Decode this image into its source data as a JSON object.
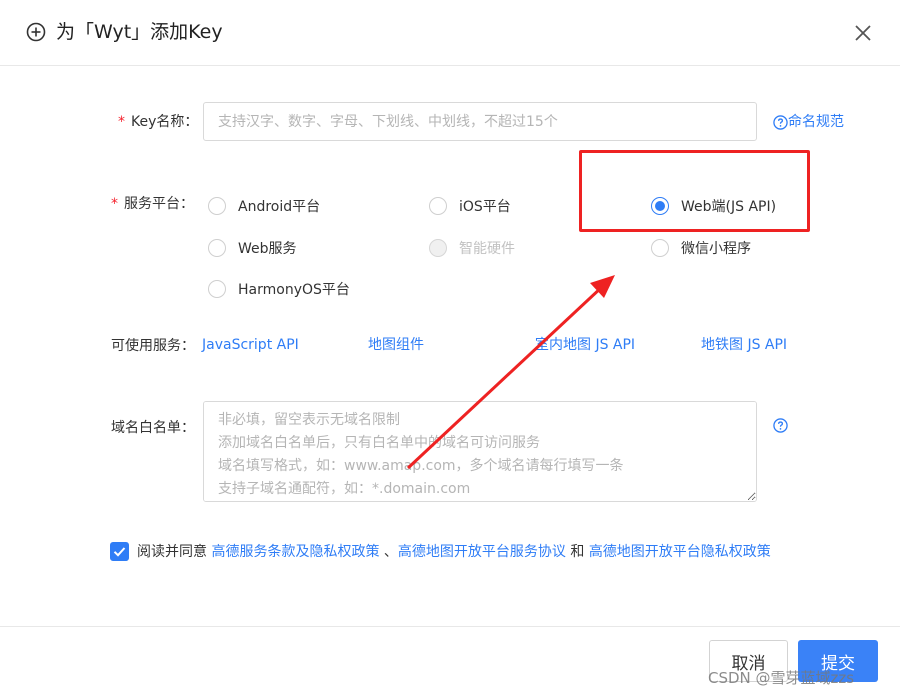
{
  "header": {
    "title": "为「Wyt」添加Key",
    "add_icon": "circle-plus-icon",
    "close_icon": "close-icon"
  },
  "form": {
    "key_name": {
      "required_mark": "*",
      "label": "Key名称：",
      "placeholder": "支持汉字、数字、字母、下划线、中划线，不超过15个",
      "value": "",
      "help_link": "命名规范"
    },
    "platform": {
      "required_mark": "*",
      "label": "服务平台：",
      "options": [
        {
          "label": "Android平台",
          "state": "unchecked"
        },
        {
          "label": "iOS平台",
          "state": "unchecked"
        },
        {
          "label": "Web端(JS API)",
          "state": "checked"
        },
        {
          "label": "Web服务",
          "state": "unchecked"
        },
        {
          "label": "智能硬件",
          "state": "disabled"
        },
        {
          "label": "微信小程序",
          "state": "unchecked"
        },
        {
          "label": "HarmonyOS平台",
          "state": "unchecked"
        }
      ]
    },
    "services": {
      "label": "可使用服务：",
      "items": [
        "JavaScript API",
        "地图组件",
        "室内地图 JS API",
        "地铁图 JS API"
      ]
    },
    "domain_whitelist": {
      "label": "域名白名单：",
      "placeholder": "非必填，留空表示无域名限制\n添加域名白名单后，只有白名单中的域名可访问服务\n域名填写格式，如：www.amap.com，多个域名请每行填写一条\n支持子域名通配符，如：*.domain.com",
      "value": ""
    },
    "agreement": {
      "checked": true,
      "prefix": "阅读并同意",
      "link1": "高德服务条款及隐私权政策",
      "sep1": "、",
      "link2": "高德地图开放平台服务协议",
      "sep2": "和",
      "link3": "高德地图开放平台隐私权政策"
    }
  },
  "footer": {
    "cancel_label": "取消",
    "submit_label": "提交"
  },
  "watermark": "CSDN @雪芽蓝域zzs",
  "colors": {
    "accent": "#2f7df6",
    "required": "#f5222d",
    "annotation": "#ee2222"
  }
}
